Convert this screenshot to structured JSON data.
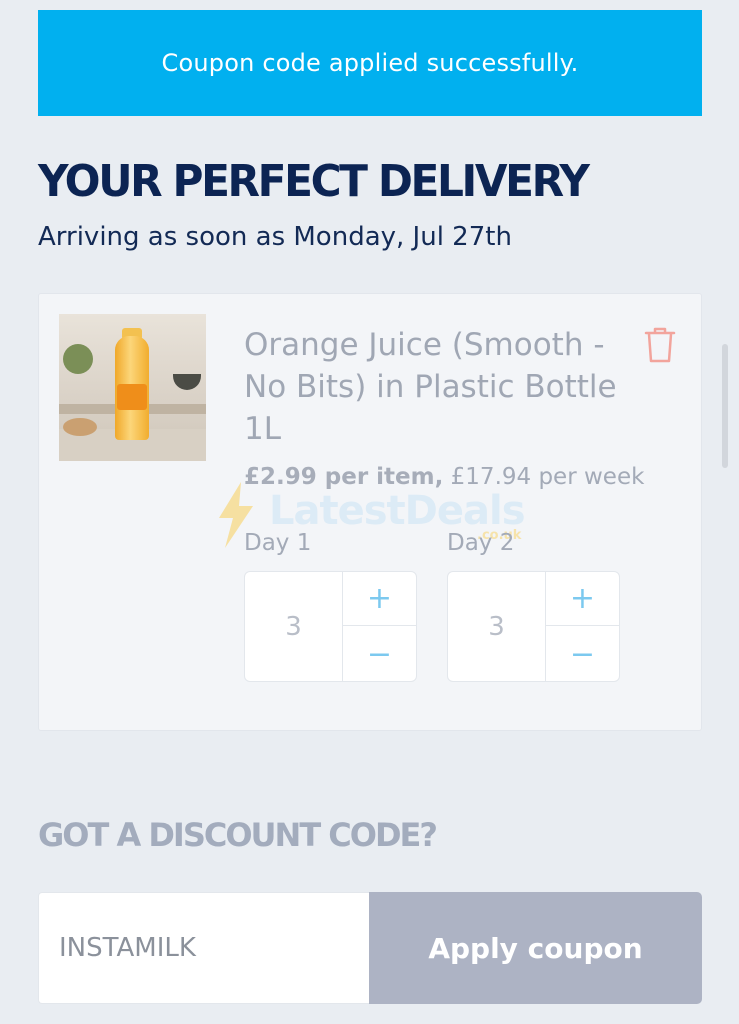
{
  "banner": {
    "message": "Coupon code applied successfully."
  },
  "delivery": {
    "heading": "YOUR PERFECT DELIVERY",
    "arrival": "Arriving as soon as Monday, Jul 27th"
  },
  "item": {
    "title": "Orange Juice (Smooth - No Bits) in Plastic Bottle 1L",
    "price_per_item": "£2.99 per item,",
    "price_per_week": " £17.94 per week",
    "days": [
      {
        "label": "Day 1",
        "quantity": "3",
        "plus": "+",
        "minus": "−"
      },
      {
        "label": "Day 2",
        "quantity": "3",
        "plus": "+",
        "minus": "−"
      }
    ]
  },
  "watermark": {
    "text": "LatestDeals",
    "sub": ".co.uk"
  },
  "discount": {
    "heading": "GOT A DISCOUNT CODE?",
    "code_value": "INSTAMILK",
    "apply_label": "Apply coupon"
  },
  "colors": {
    "banner": "#01b0ef",
    "heading": "#0c2453",
    "stepper_accent": "#7cc9ef",
    "trash": "#f2a49c",
    "apply_button": "#adb3c4"
  }
}
